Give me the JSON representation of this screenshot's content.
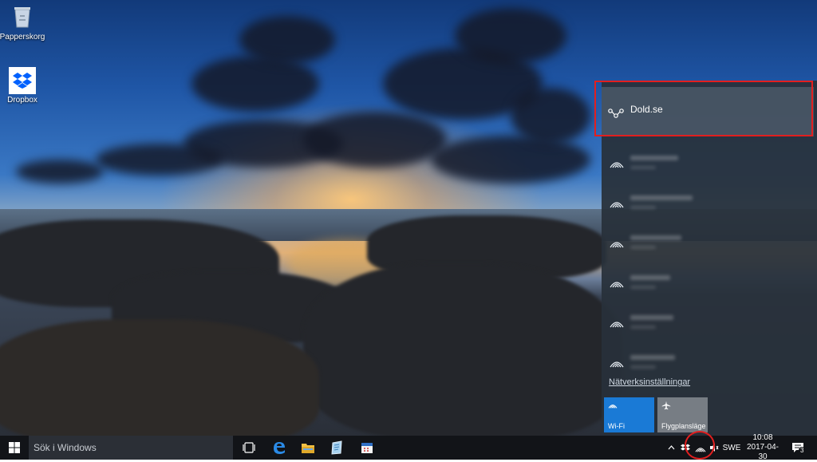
{
  "desktop": {
    "icons": [
      {
        "label": "Papperskorg",
        "icon": "recycle-bin-icon"
      },
      {
        "label": "Dropbox",
        "icon": "dropbox-icon"
      }
    ]
  },
  "network_flyout": {
    "selected_network": {
      "name": "Dold.se",
      "icon": "vpn-icon"
    },
    "other_networks_count": 6,
    "settings_link": "Nätverksinställningar",
    "quick_actions": [
      {
        "label": "Wi-Fi",
        "icon": "wifi-icon",
        "active": true
      },
      {
        "label": "Flygplansläge",
        "icon": "airplane-icon",
        "active": false
      }
    ],
    "highlight_color": "#e21f1f",
    "accent": "#1a7ad6"
  },
  "taskbar": {
    "search_placeholder": "Sök i Windows",
    "pinned": [
      "task-view-icon",
      "edge-icon",
      "file-explorer-icon",
      "notepad-icon",
      "calendar-icon"
    ],
    "tray": {
      "language": "SWE",
      "time": "10:08",
      "date": "2017-04-30",
      "notification_count": "3"
    }
  }
}
